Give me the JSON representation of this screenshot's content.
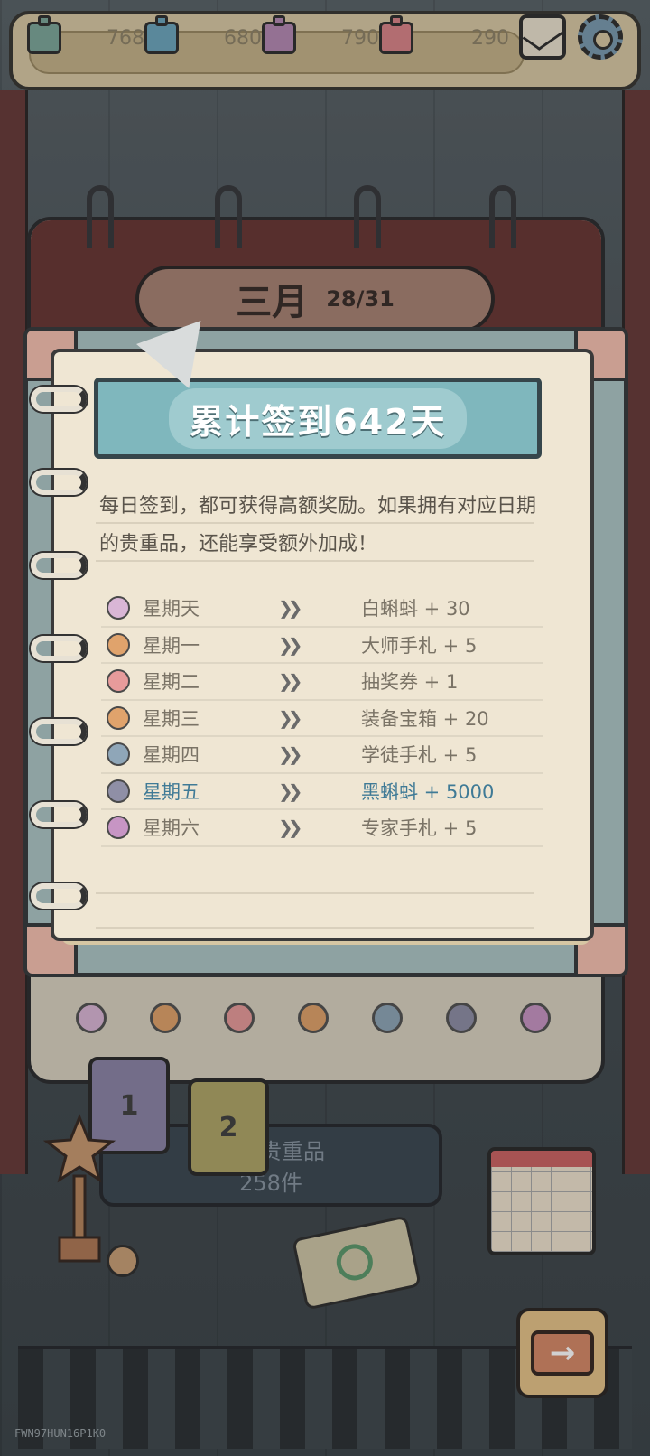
{
  "resources": [
    {
      "name": "white-tadpole-resource",
      "value": "7686",
      "color": "#7ea89b"
    },
    {
      "name": "blue-resource",
      "value": "6804",
      "color": "#6ea7bd"
    },
    {
      "name": "purple-resource",
      "value": "7901",
      "color": "#b58ab4"
    },
    {
      "name": "red-resource",
      "value": "290",
      "color": "#d9868a"
    }
  ],
  "calendar": {
    "month": "三月",
    "day_progress": "28/31",
    "collection_label": "稀有贵重品",
    "collection_count": "258件",
    "card_1": "1",
    "card_2": "2"
  },
  "popup": {
    "banner": "累计签到642天",
    "description": "每日签到，都可获得高额奖励。如果拥有对应日期的贵重品，还能享受额外加成！",
    "rewards": [
      {
        "day": "星期天",
        "reward": "白蝌蚪 + 30",
        "icon": "tadpole-icon",
        "icon_color": "#d9b6d6",
        "highlight": false
      },
      {
        "day": "星期一",
        "reward": "大师手札 + 5",
        "icon": "master-notes-icon",
        "icon_color": "#e0a36c",
        "highlight": false
      },
      {
        "day": "星期二",
        "reward": "抽奖券 + 1",
        "icon": "lottery-ticket-icon",
        "icon_color": "#e79b9b",
        "highlight": false
      },
      {
        "day": "星期三",
        "reward": "装备宝箱 + 20",
        "icon": "treasure-chest-icon",
        "icon_color": "#e0a36c",
        "highlight": false
      },
      {
        "day": "星期四",
        "reward": "学徒手札 + 5",
        "icon": "apprentice-notes-icon",
        "icon_color": "#8fa6b8",
        "highlight": false
      },
      {
        "day": "星期五",
        "reward": "黑蝌蚪 + 5000",
        "icon": "black-tadpole-icon",
        "icon_color": "#8f8fa6",
        "highlight": true
      },
      {
        "day": "星期六",
        "reward": "专家手札 + 5",
        "icon": "expert-notes-icon",
        "icon_color": "#c795c4",
        "highlight": false
      }
    ]
  },
  "next_button": "→",
  "watermark": "FWN97HUN16P1K0"
}
